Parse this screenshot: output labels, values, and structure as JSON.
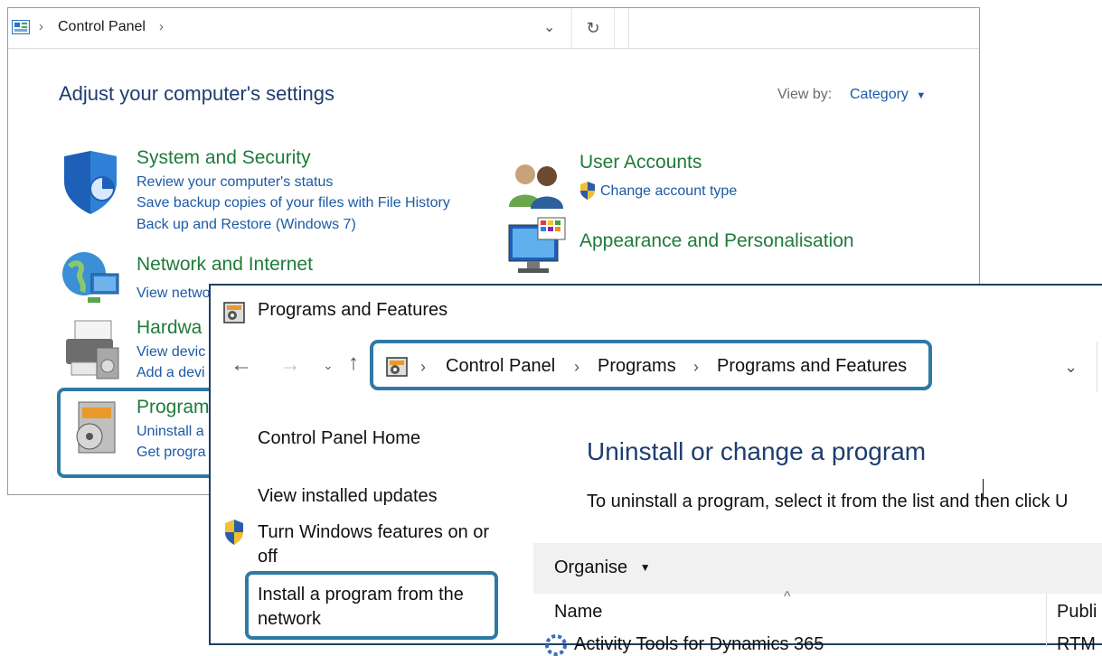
{
  "control_panel": {
    "breadcrumb": "Control Panel",
    "title": "Adjust your computer's settings",
    "view_by_label": "View by:",
    "view_by_value": "Category",
    "categories": {
      "system_security": {
        "heading": "System and Security",
        "links": [
          "Review your computer's status",
          "Save backup copies of your files with File History",
          "Back up and Restore (Windows 7)"
        ]
      },
      "network": {
        "heading": "Network and Internet",
        "link": "View netwo"
      },
      "hardware": {
        "heading": "Hardwa",
        "links": [
          "View devic",
          "Add a devi"
        ]
      },
      "programs": {
        "heading": "Program",
        "links": [
          "Uninstall a",
          "Get progra"
        ]
      },
      "user_accounts": {
        "heading": "User Accounts",
        "link": "Change account type"
      },
      "appearance": {
        "heading": "Appearance and Personalisation"
      }
    }
  },
  "programs_features": {
    "window_title": "Programs and Features",
    "breadcrumb": [
      "Control Panel",
      "Programs",
      "Programs and Features"
    ],
    "sidebar": {
      "home": "Control Panel Home",
      "updates": "View installed updates",
      "features_line1": "Turn Windows features on or",
      "features_line2": "off",
      "network_line1": "Install a program from the",
      "network_line2": "network"
    },
    "heading": "Uninstall or change a program",
    "instruction": "To uninstall a program, select it from the list and then click U",
    "toolbar": {
      "organise": "Organise"
    },
    "columns": {
      "name": "Name",
      "publisher": "Publi"
    },
    "rows": [
      {
        "name": "Activity Tools for Dynamics 365",
        "publisher": "RTM"
      }
    ]
  },
  "colors": {
    "highlight": "#2e7aa5",
    "category_green": "#1f7b3a",
    "link_blue": "#1c5aa6",
    "title_blue": "#1e3d6e"
  }
}
